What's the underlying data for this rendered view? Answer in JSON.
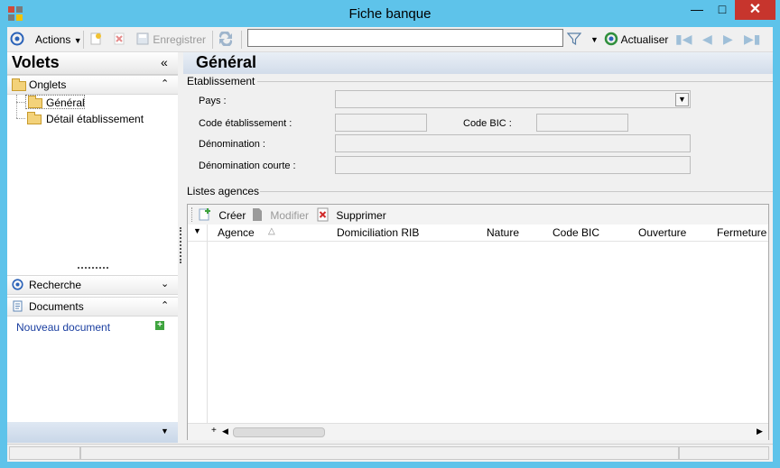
{
  "window": {
    "title": "Fiche banque",
    "minimize_glyph": "—",
    "maximize_glyph": "□",
    "close_glyph": "✕"
  },
  "toolbar": {
    "actions_label": "Actions",
    "save_label": "Enregistrer",
    "search_value": "",
    "refresh_label": "Actualiser"
  },
  "left": {
    "volets_title": "Volets",
    "volets_collapse_glyph": "«",
    "onglets_label": "Onglets",
    "tabs": [
      {
        "label": "Général"
      },
      {
        "label": "Détail établissement"
      }
    ],
    "recherche_label": "Recherche",
    "documents_label": "Documents",
    "new_document_label": "Nouveau document"
  },
  "right": {
    "header_title": "Général",
    "etablissement_group": "Etablissement",
    "fields": {
      "pays_label": "Pays :",
      "pays_value": "",
      "code_etab_label": "Code établissement :",
      "code_etab_value": "",
      "code_bic_label": "Code BIC  :",
      "code_bic_value": "",
      "denomination_label": "Dénomination :",
      "denomination_value": "",
      "denomination_courte_label": "Dénomination courte :",
      "denomination_courte_value": ""
    },
    "agences_group": "Listes agences",
    "grid": {
      "create_label": "Créer",
      "modify_label": "Modifier",
      "delete_label": "Supprimer",
      "columns": [
        "Agence",
        "Domiciliation RIB",
        "Nature",
        "Code BIC",
        "Ouverture",
        "Fermeture"
      ],
      "rows": []
    }
  },
  "colors": {
    "titlebar": "#5ec3ea",
    "close_button": "#c7352d",
    "header_gradient_end": "#d2dcea"
  }
}
